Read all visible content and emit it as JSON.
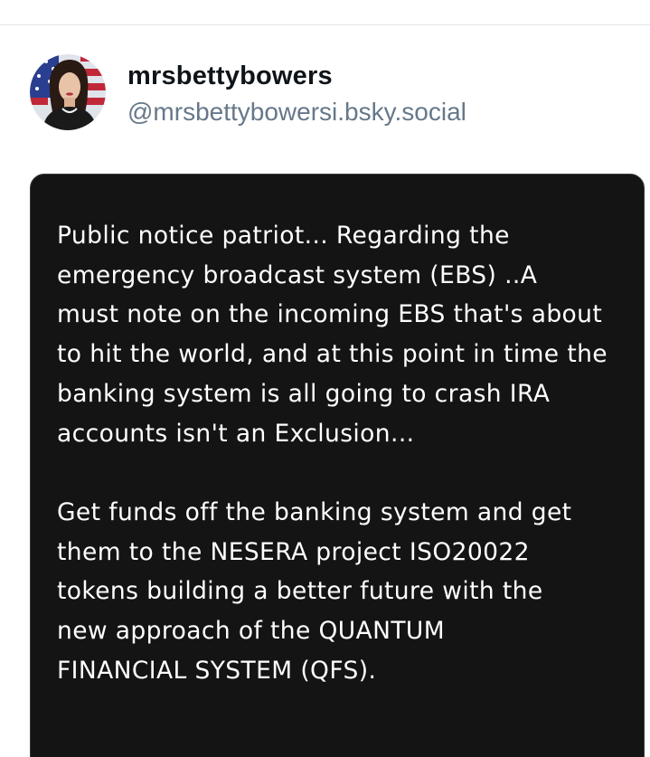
{
  "post": {
    "author": {
      "display_name": "mrsbettybowers",
      "handle": "@mrsbettybowersi.bsky.social",
      "avatar_icon": "profile-photo"
    },
    "image_text": {
      "paragraph_1": "Public notice patriot... Regarding the\nemergency broadcast system (EBS) ..A\nmust note on the incoming EBS that's about\nto hit the world, and at this point in time the\nbanking system is all going to crash IRA\naccounts isn't an Exclusion...",
      "paragraph_2": "Get funds off the banking system and get\nthem to the NESERA project ISO20022\ntokens building a better future with the\nnew approach of the QUANTUM\nFINANCIAL SYSTEM (QFS)."
    }
  },
  "colors": {
    "handle": "#66788a",
    "card_background": "#141414",
    "card_text": "#ffffff"
  }
}
